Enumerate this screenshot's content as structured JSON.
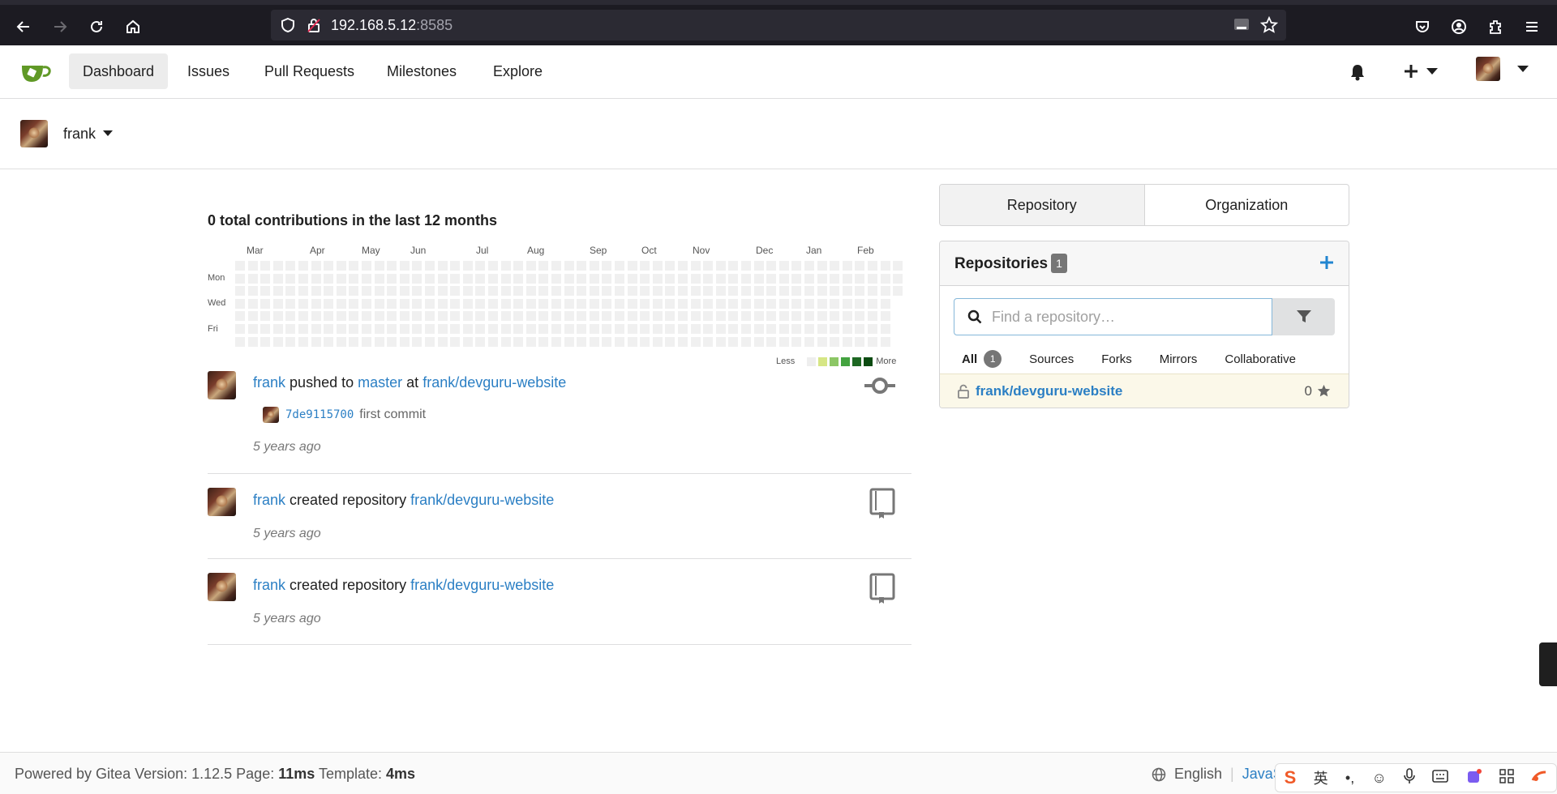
{
  "browser": {
    "url_host": "192.168.5.12",
    "url_port": ":8585",
    "icons": [
      "back-icon",
      "forward-icon",
      "reload-icon",
      "home-icon",
      "shield-icon",
      "lock-icon",
      "reader-icon",
      "star-icon",
      "pocket-icon",
      "account-icon",
      "extensions-icon",
      "menu-icon"
    ]
  },
  "navbar": {
    "items": [
      {
        "label": "Dashboard",
        "active": true
      },
      {
        "label": "Issues"
      },
      {
        "label": "Pull Requests"
      },
      {
        "label": "Milestones"
      },
      {
        "label": "Explore"
      }
    ]
  },
  "context": {
    "username": "frank"
  },
  "heatmap": {
    "title": "0 total contributions in the last 12 months",
    "months": [
      "Mar",
      "Apr",
      "May",
      "Jun",
      "Jul",
      "Aug",
      "Sep",
      "Oct",
      "Nov",
      "Dec",
      "Jan",
      "Feb"
    ],
    "days": [
      "Mon",
      "Wed",
      "Fri"
    ],
    "legend_less": "Less",
    "legend_more": "More",
    "legend_colors": [
      "#eeeeee",
      "#d6e685",
      "#8cc665",
      "#44a340",
      "#1e6823",
      "#0b4b11"
    ],
    "contributions": 0
  },
  "feeds": [
    {
      "user": "frank",
      "action": "pushed to",
      "branch": "master",
      "at": "at",
      "repo": "frank/devguru-website",
      "commit_sha": "7de9115700",
      "commit_msg": "first commit",
      "time": "5 years ago",
      "icon": "commit-icon"
    },
    {
      "user": "frank",
      "action": "created repository",
      "repo": "frank/devguru-website",
      "time": "5 years ago",
      "icon": "repo-book-icon"
    },
    {
      "user": "frank",
      "action": "created repository",
      "repo": "frank/devguru-website",
      "time": "5 years ago",
      "icon": "repo-book-icon"
    }
  ],
  "side": {
    "tabs": [
      "Repository",
      "Organization"
    ],
    "repos_title": "Repositories",
    "repos_count": "1",
    "search_placeholder": "Find a repository…",
    "filters": [
      {
        "label": "All",
        "badge": "1"
      },
      {
        "label": "Sources"
      },
      {
        "label": "Forks"
      },
      {
        "label": "Mirrors"
      },
      {
        "label": "Collaborative"
      }
    ],
    "repo": {
      "name": "frank/devguru-website",
      "stars": "0"
    }
  },
  "footer": {
    "powered": "Powered by Gitea Version: 1.12.5 Page: ",
    "page_time": "11ms",
    "template_label": " Template: ",
    "template_time": "4ms",
    "language": "English",
    "js_link": "JavaS"
  },
  "ime": {
    "items": [
      "英",
      "•,",
      "☺",
      "mic",
      "kbd",
      "skin",
      "grid",
      "tool"
    ]
  }
}
